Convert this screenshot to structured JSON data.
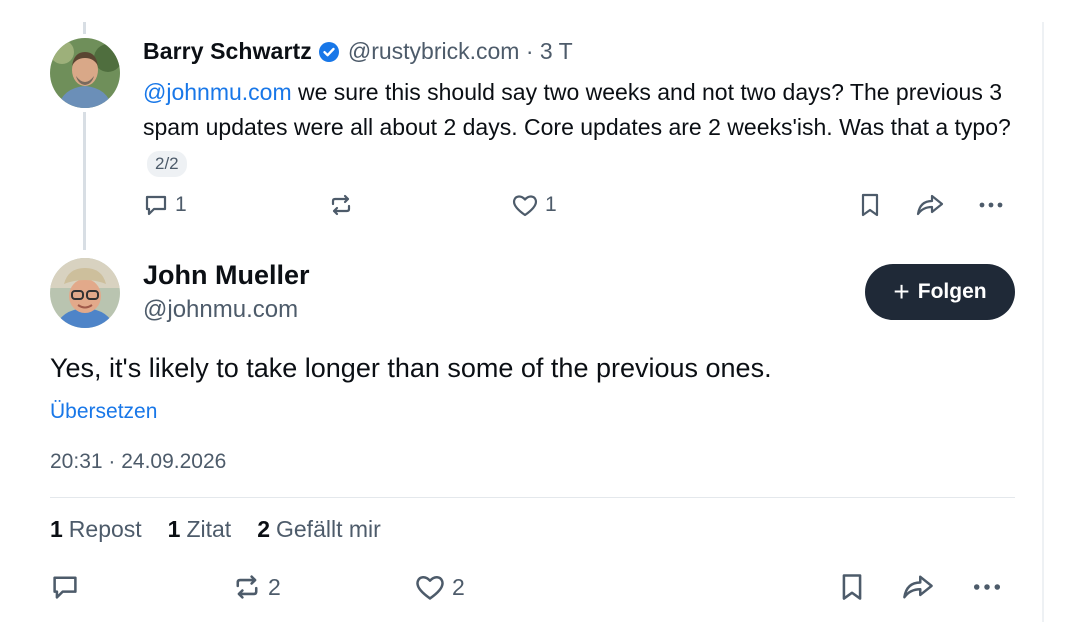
{
  "parent_post": {
    "author_name": "Barry Schwartz",
    "handle_time": "@rustybrick.com · 3 T",
    "mention": "@johnmu.com",
    "text": " we sure this should say two weeks and not two days? The previous 3 spam updates were all about 2 days.  Core updates are 2 weeks'ish.  Was that a typo?",
    "thread_pill": "2/2",
    "reply_count": "1",
    "like_count": "1"
  },
  "main_post": {
    "author_name": "John Mueller",
    "handle": "@johnmu.com",
    "follow_label": "Folgen",
    "text": "Yes, it's likely to take longer than some of the previous ones.",
    "translate_label": "Übersetzen",
    "timestamp": "20:31 · 24.09.2026",
    "stats": {
      "reposts_count": "1",
      "reposts_label": "Repost",
      "quotes_count": "1",
      "quotes_label": "Zitat",
      "likes_count": "2",
      "likes_label": "Gefällt mir"
    },
    "repost_count": "2",
    "like_count": "2"
  },
  "colors": {
    "accent": "#1877e8",
    "muted": "#4d5b6a",
    "button_bg": "#1f2937"
  },
  "icons": [
    "verified-badge-icon",
    "reply-icon",
    "repost-icon",
    "like-icon",
    "bookmark-icon",
    "share-icon",
    "more-icon"
  ]
}
